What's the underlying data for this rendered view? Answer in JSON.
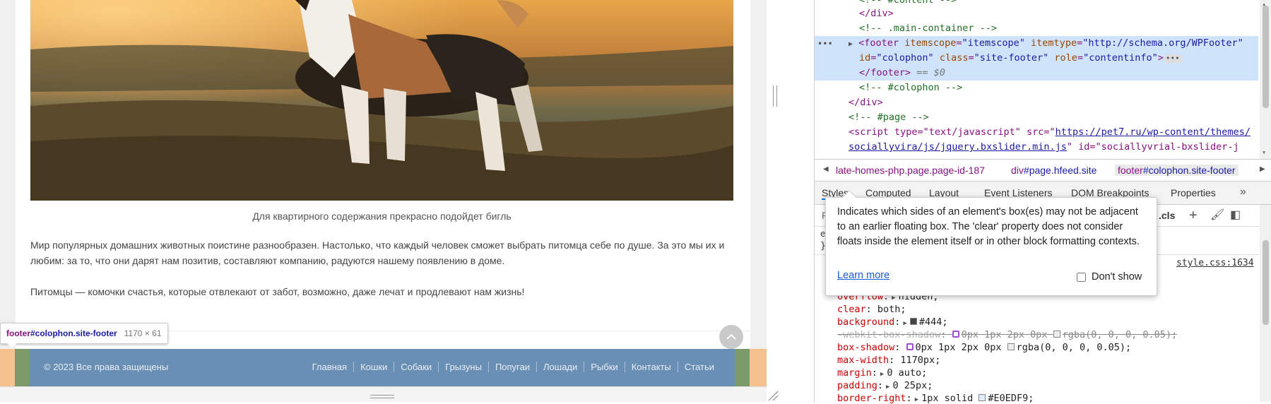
{
  "page": {
    "caption": "Для квартирного содержания прекрасно подойдет бигль",
    "paragraph1": "Мир популярных домашних животных поистине разнообразен. Настолько, что каждый человек сможет выбрать питомца себе по душе. За это мы их и любим: за то, что они дарят нам позитив, составляют компанию, радуются нашему появлению в доме.",
    "paragraph2": "Питомцы — комочки счастья, которые отвлекают от забот, возможно, даже лечат и продлевают нам жизнь!",
    "inspect_tooltip": {
      "tag": "footer",
      "selector": "#colophon.site-footer",
      "size": "1170 × 61"
    },
    "footer": {
      "copyright": "© 2023 Все права защищены",
      "nav": [
        "Главная",
        "Кошки",
        "Собаки",
        "Грызуны",
        "Попугаи",
        "Лошади",
        "Рыбки",
        "Контакты",
        "Статьи"
      ]
    }
  },
  "devtools": {
    "dom": {
      "line0": "<!-- #content -->",
      "line1": "</div>",
      "line2": "<!-- .main-container -->",
      "line3_tag": "<footer ",
      "line3_attrs": [
        {
          "n": "itemscope",
          "v": "\"itemscope\""
        },
        {
          "n": "itemtype",
          "v": "\"http://schema.org/WPFooter\""
        }
      ],
      "line4_attrs": [
        {
          "n": "id",
          "v": "\"colophon\""
        },
        {
          "n": "class",
          "v": "\"site-footer\""
        },
        {
          "n": "role",
          "v": "\"contentinfo\""
        }
      ],
      "line5": "</footer>",
      "line5_marker": "== $0",
      "line6": "<!-- #colophon -->",
      "line7": "</div>",
      "line8": "<!-- #page -->",
      "line9_prefix": "<script type=\"text/javascript\" src=\"",
      "line9_link": "https://pet7.ru/wp-content/themes/",
      "line10_link": "sociallyvira/js/jquery.bxslider.min.js",
      "line10_suffix": "\" id=\"sociallyvrial-bxslider-j"
    },
    "breadcrumbs": [
      {
        "tag": "late-homes-php.page.page-id-187",
        "cls": ""
      },
      {
        "tag": "div",
        "cls": "#page.hfeed.site"
      },
      {
        "tag": "footer",
        "cls": "#colophon.site-footer"
      }
    ],
    "tabs": [
      "Styles",
      "Computed",
      "Layout",
      "Event Listeners",
      "DOM Breakpoints",
      "Properties"
    ],
    "filter_placeholder": "F",
    "cls_label": ".cls",
    "element_style": "e",
    "rule_source": "style.css:1634",
    "props": {
      "overflow": {
        "name": "overflow",
        "value": "hidden;"
      },
      "clear": {
        "name": "clear",
        "value": "both;"
      },
      "background": {
        "name": "background",
        "value": "#444;",
        "color": "#444444"
      },
      "webkit": {
        "name": "-webkit-box-shadow",
        "value1": "0px 1px 2px 0px",
        "value2": "rgba(0, 0, 0, 0.05);"
      },
      "boxshadow": {
        "name": "box-shadow",
        "value1": "0px 1px 2px 0px",
        "value2": "rgba(0, 0, 0, 0.05);"
      },
      "maxwidth": {
        "name": "max-width",
        "value": "1170px;"
      },
      "margin": {
        "name": "margin",
        "value": "0 auto;"
      },
      "padding": {
        "name": "padding",
        "value": "0 25px;"
      },
      "borderright": {
        "name": "border-right",
        "value": "1px solid",
        "color_text": "#E0EDF9;",
        "color": "#E0EDF9"
      }
    },
    "popover": {
      "text": "Indicates which sides of an element's box(es) may not be adjacent to an earlier floating box. The 'clear' property does not consider floats inside the element itself or in other block formatting contexts.",
      "learn_more": "Learn more",
      "dont_show": "Don't show"
    }
  },
  "colors": {
    "footer_bg": "#6a8fb5",
    "selection": "#cfe3fb",
    "tag": "#881280",
    "attr": "#994500",
    "value": "#1a1aa6"
  }
}
